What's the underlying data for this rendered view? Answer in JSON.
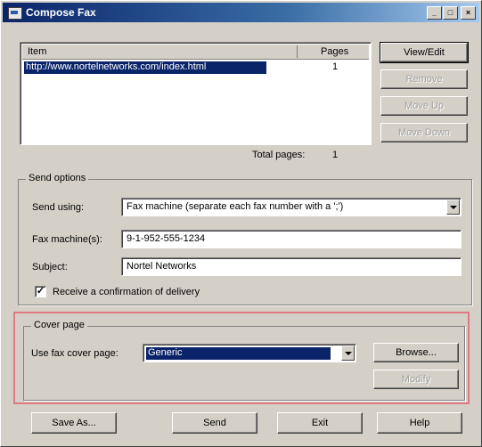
{
  "window": {
    "title": "Compose Fax"
  },
  "titlebar_buttons": {
    "minimize": "_",
    "maximize": "□",
    "close": "×"
  },
  "items": {
    "header_item": "Item",
    "header_pages": "Pages",
    "rows": [
      {
        "item": "http://www.nortelnetworks.com/index.html",
        "pages": "1"
      }
    ],
    "total_label": "Total pages:",
    "total_value": "1"
  },
  "side_buttons": {
    "view_edit": "View/Edit",
    "remove": "Remove",
    "move_up": "Move Up",
    "move_down": "Move Down"
  },
  "send_options": {
    "legend": "Send options",
    "send_using_label": "Send using:",
    "send_using_value": "Fax machine (separate each fax number with a ';')",
    "fax_label": "Fax machine(s):",
    "fax_value": "9-1-952-555-1234",
    "subject_label": "Subject:",
    "subject_value": "Nortel Networks",
    "confirm_label": "Receive a confirmation of delivery",
    "confirm_checked": true
  },
  "cover_page": {
    "legend": "Cover page",
    "use_label": "Use fax cover page:",
    "use_value": "Generic",
    "browse": "Browse...",
    "modify": "Modify"
  },
  "bottom_buttons": {
    "save_as": "Save As...",
    "send": "Send",
    "exit": "Exit",
    "help": "Help"
  },
  "colors": {
    "titlebar_start": "#0a246a",
    "selection": "#0a246a",
    "dialog_face": "#d4d0c8",
    "highlight_border": "#e07a82"
  }
}
